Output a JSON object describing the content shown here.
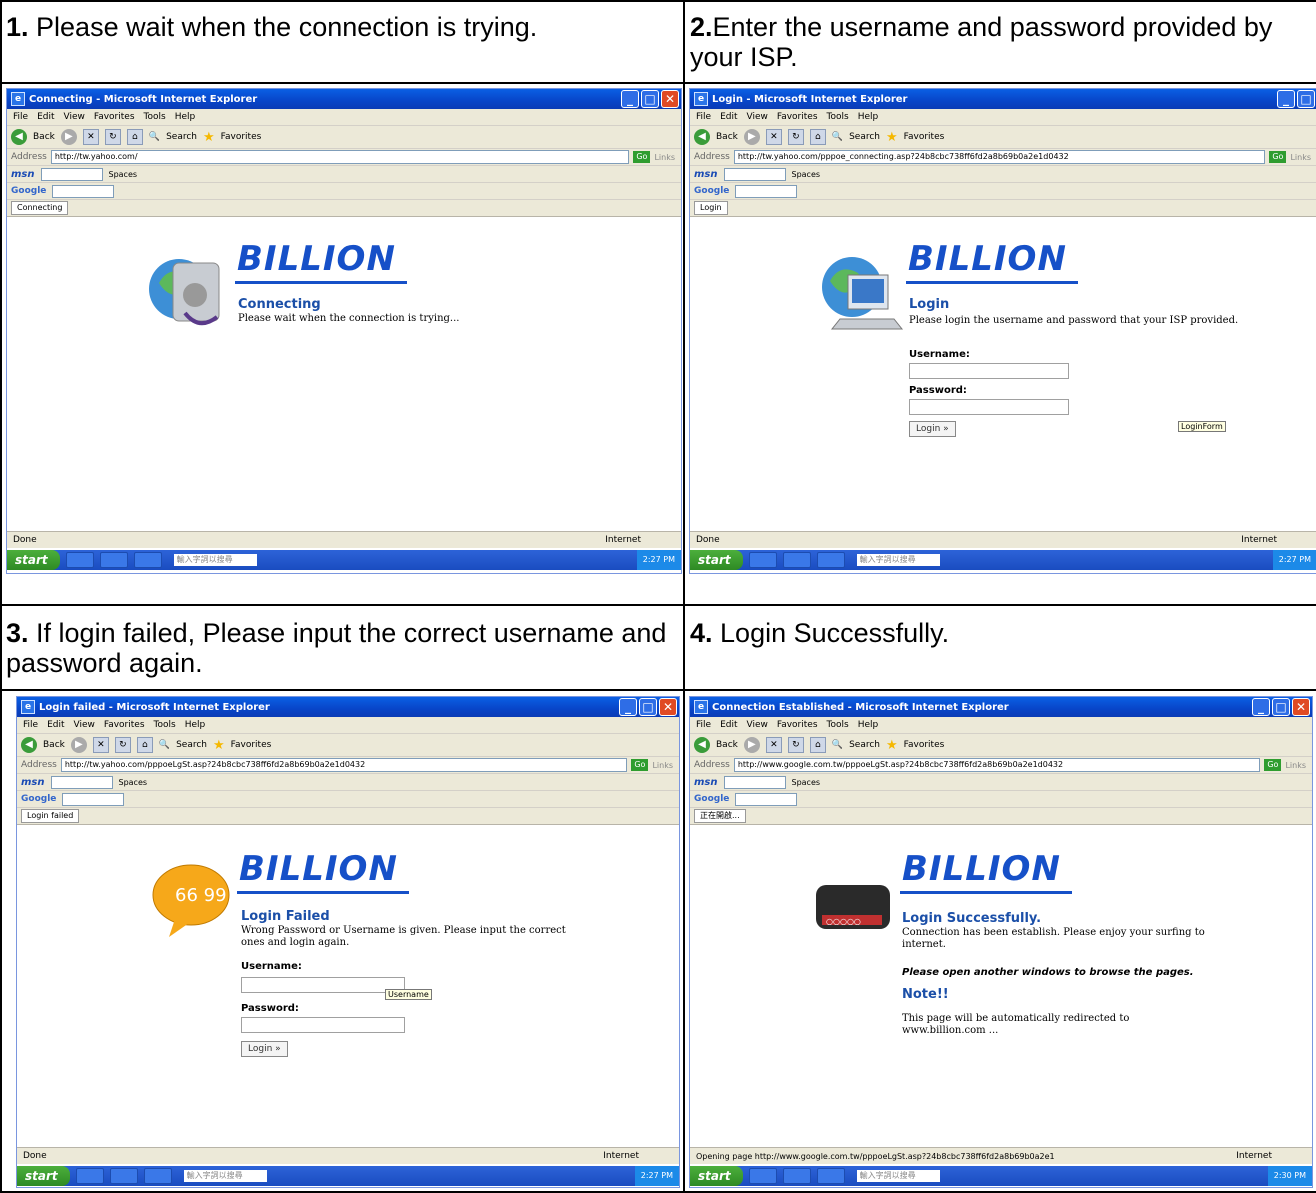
{
  "captions": {
    "c1_num": "1.",
    "c1_text": " Please wait when the connection is trying.",
    "c2_num": "2.",
    "c2_text": "Enter the username and password provided by your ISP.",
    "c3_num": "3.",
    "c3_text": " If login failed, Please input the correct username and password again.",
    "c4_num": "4.",
    "c4_text": " Login Successfully."
  },
  "browser": {
    "menu": [
      "File",
      "Edit",
      "View",
      "Favorites",
      "Tools",
      "Help"
    ],
    "back": "Back",
    "search": "Search",
    "favorites": "Favorites",
    "address_label": "Address",
    "go": "Go",
    "links": "Links",
    "spaces": "Spaces",
    "google": "Google",
    "start": "start",
    "done": "Done",
    "internet": "Internet",
    "search_cn": "輸入字詞以搜尋"
  },
  "shots": {
    "s1": {
      "title": "Connecting - Microsoft Internet Explorer",
      "address": "http://tw.yahoo.com/",
      "tab": "Connecting",
      "logo": "BILLION",
      "heading": "Connecting",
      "text": "Please wait when the connection is trying...",
      "status": "Done",
      "time": "2:27 PM"
    },
    "s2": {
      "title": "Login - Microsoft Internet Explorer",
      "address": "http://tw.yahoo.com/pppoe_connecting.asp?24b8cbc738ff6fd2a8b69b0a2e1d0432",
      "tab": "Login",
      "logo": "BILLION",
      "heading": "Login",
      "text": "Please login the username and password that your ISP provided.",
      "username_label": "Username:",
      "password_label": "Password:",
      "login_btn": "Login »",
      "tip": "LoginForm",
      "status": "Done",
      "time": "2:27 PM"
    },
    "s3": {
      "title": "Login failed - Microsoft Internet Explorer",
      "address": "http://tw.yahoo.com/pppoeLgSt.asp?24b8cbc738ff6fd2a8b69b0a2e1d0432",
      "tab": "Login failed",
      "logo": "BILLION",
      "heading": "Login Failed",
      "text": "Wrong Password or Username is given. Please input the correct ones and login again.",
      "username_label": "Username:",
      "password_label": "Password:",
      "login_btn": "Login »",
      "tip": "Username",
      "status": "Done",
      "time": "2:27 PM"
    },
    "s4": {
      "title": "Connection Established - Microsoft Internet Explorer",
      "address": "http://www.google.com.tw/pppoeLgSt.asp?24b8cbc738ff6fd2a8b69b0a2e1d0432",
      "tab": "正在開啟...",
      "logo": "BILLION",
      "heading": "Login Successfully.",
      "text": "Connection has been establish. Please enjoy your surfing to internet.",
      "notice": "Please open another windows to browse the pages.",
      "note": "Note!!",
      "redirect": "This page will be automatically redirected to www.billion.com ...",
      "status": "Opening page http://www.google.com.tw/pppoeLgSt.asp?24b8cbc738ff6fd2a8b69b0a2e1",
      "time": "2:30 PM"
    }
  }
}
